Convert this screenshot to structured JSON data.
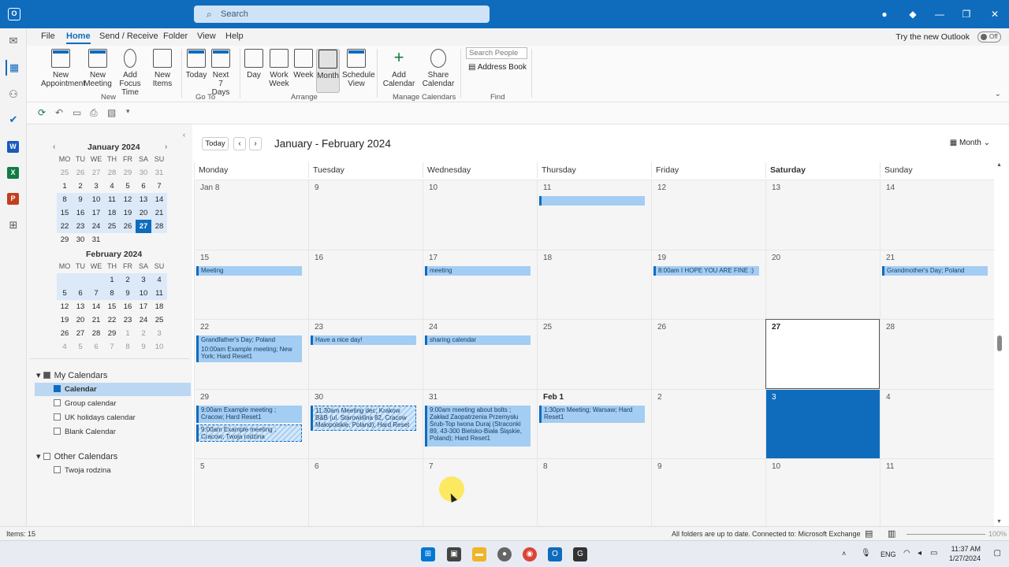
{
  "titlebar": {
    "search_placeholder": "Search"
  },
  "menu": {
    "tabs": [
      "File",
      "Home",
      "Send / Receive",
      "Folder",
      "View",
      "Help"
    ],
    "active": "Home",
    "try_new": "Try the new Outlook",
    "toggle": "Off"
  },
  "ribbon": {
    "new_group": {
      "label": "New",
      "buttons": [
        "New Appointment",
        "New Meeting",
        "Add Focus Time",
        "New Items"
      ]
    },
    "goto_group": {
      "label": "Go To",
      "buttons": [
        "Today",
        "Next 7 Days"
      ]
    },
    "arrange_group": {
      "label": "Arrange",
      "buttons": [
        "Day",
        "Work Week",
        "Week",
        "Month",
        "Schedule View"
      ]
    },
    "manage_group": {
      "label": "Manage Calendars",
      "buttons": [
        "Add Calendar",
        "Share Calendar"
      ]
    },
    "find_group": {
      "label": "Find",
      "search_people": "Search People",
      "address_book": "Address Book"
    }
  },
  "minical": {
    "jan_title": "January 2024",
    "feb_title": "February 2024",
    "dow": [
      "MO",
      "TU",
      "WE",
      "TH",
      "FR",
      "SA",
      "SU"
    ],
    "jan": [
      [
        "25",
        "26",
        "27",
        "28",
        "29",
        "30",
        "31"
      ],
      [
        "1",
        "2",
        "3",
        "4",
        "5",
        "6",
        "7"
      ],
      [
        "8",
        "9",
        "10",
        "11",
        "12",
        "13",
        "14"
      ],
      [
        "15",
        "16",
        "17",
        "18",
        "19",
        "20",
        "21"
      ],
      [
        "22",
        "23",
        "24",
        "25",
        "26",
        "27",
        "28"
      ],
      [
        "29",
        "30",
        "31"
      ]
    ],
    "feb": [
      [
        "",
        "",
        "",
        "1",
        "2",
        "3",
        "4"
      ],
      [
        "5",
        "6",
        "7",
        "8",
        "9",
        "10",
        "11"
      ],
      [
        "12",
        "13",
        "14",
        "15",
        "16",
        "17",
        "18"
      ],
      [
        "19",
        "20",
        "21",
        "22",
        "23",
        "24",
        "25"
      ],
      [
        "26",
        "27",
        "28",
        "29",
        "1",
        "2",
        "3"
      ],
      [
        "4",
        "5",
        "6",
        "7",
        "8",
        "9",
        "10"
      ]
    ]
  },
  "folders": {
    "my_header": "My Calendars",
    "my": [
      "Calendar",
      "Group calendar",
      "UK holidays calendar",
      "Blank Calendar"
    ],
    "other_header": "Other Calendars",
    "other": [
      "Twoja rodzina"
    ]
  },
  "calendar": {
    "today_btn": "Today",
    "range_title": "January - February 2024",
    "view": "Month",
    "dow": [
      "Monday",
      "Tuesday",
      "Wednesday",
      "Thursday",
      "Friday",
      "Saturday",
      "Sunday"
    ],
    "weeks": [
      [
        "Jan 8",
        "9",
        "10",
        "11",
        "12",
        "13",
        "14"
      ],
      [
        "15",
        "16",
        "17",
        "18",
        "19",
        "20",
        "21"
      ],
      [
        "22",
        "23",
        "24",
        "25",
        "26",
        "27",
        "28"
      ],
      [
        "29",
        "30",
        "31",
        "Feb 1",
        "2",
        "3",
        "4"
      ],
      [
        "5",
        "6",
        "7",
        "8",
        "9",
        "10",
        "11"
      ]
    ],
    "events": [
      {
        "week": 0,
        "day": 3,
        "text": "",
        "tent": false,
        "slot": 0,
        "lines": 1
      },
      {
        "week": 1,
        "day": 0,
        "text": "Meeting",
        "tent": false,
        "slot": 0,
        "lines": 1
      },
      {
        "week": 1,
        "day": 2,
        "text": "meeting",
        "tent": false,
        "slot": 0,
        "lines": 1
      },
      {
        "week": 1,
        "day": 4,
        "text": "8:00am I HOPE YOU ARE FINE :)",
        "tent": false,
        "slot": 0,
        "lines": 1
      },
      {
        "week": 1,
        "day": 6,
        "text": "Grandmother's Day; Poland",
        "tent": false,
        "slot": 0,
        "lines": 1
      },
      {
        "week": 2,
        "day": 0,
        "text": "Grandfather's Day; Poland",
        "tent": false,
        "slot": 0,
        "lines": 1
      },
      {
        "week": 2,
        "day": 0,
        "text": "10:00am Example meeting; New York; Hard Reset1",
        "tent": false,
        "slot": 1,
        "lines": 2
      },
      {
        "week": 2,
        "day": 1,
        "text": "Have a nice day!",
        "tent": false,
        "slot": 0,
        "lines": 1
      },
      {
        "week": 2,
        "day": 2,
        "text": "sharing calendar",
        "tent": false,
        "slot": 0,
        "lines": 1
      },
      {
        "week": 3,
        "day": 0,
        "text": "9:00am Example meeting ; Cracow; Hard Reset1",
        "tent": false,
        "slot": 0,
        "lines": 2
      },
      {
        "week": 3,
        "day": 0,
        "text": "9:00am Example meeting ; Cracow; Twoja rodzina",
        "tent": true,
        "slot": 2,
        "lines": 2
      },
      {
        "week": 3,
        "day": 1,
        "text": "11:30am Meeting dec; Krakow B&B (ul. Starowiślna 82, Cracow Małopolskie, Poland); Hard Reset",
        "tent": true,
        "slot": 0,
        "lines": 3
      },
      {
        "week": 3,
        "day": 2,
        "text": "9:00am meeting about bolts ; Zakład Zaopatrzenia Przemysłu Śrub-Top Iwona Duraj (Straconki 89, 43-300 Bielsko-Biała Śląskie, Poland); Hard Reset1",
        "tent": false,
        "slot": 0,
        "lines": 5
      },
      {
        "week": 3,
        "day": 3,
        "text": "1:30pm Meeting; Warsaw; Hard Reset1",
        "tent": false,
        "slot": 0,
        "lines": 2
      }
    ]
  },
  "status": {
    "items": "Items: 15",
    "sync": "All folders are up to date.",
    "connected": "Connected to: Microsoft Exchange",
    "zoom": "100%"
  },
  "tray": {
    "lang": "ENG",
    "time": "11:37 AM",
    "date": "1/27/2024"
  }
}
